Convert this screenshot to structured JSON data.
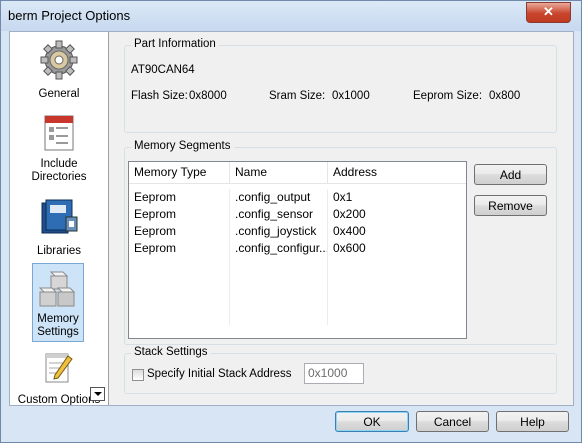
{
  "window": {
    "title": "berm Project Options",
    "close_glyph": "✕"
  },
  "sidebar": {
    "items": [
      {
        "label": "General",
        "icon": "gear-icon"
      },
      {
        "label": "Include Directories",
        "icon": "include-directories-icon"
      },
      {
        "label": "Libraries",
        "icon": "libraries-icon"
      },
      {
        "label": "Memory Settings",
        "icon": "memory-blocks-icon",
        "selected": true
      },
      {
        "label": "Custom Options",
        "icon": "notepad-pencil-icon"
      }
    ]
  },
  "part_info": {
    "group_label": "Part Information",
    "part_name": "AT90CAN64",
    "flash_label": "Flash Size:",
    "flash_value": "0x8000",
    "sram_label": "Sram  Size:",
    "sram_value": "0x1000",
    "eeprom_label": "Eeprom  Size:",
    "eeprom_value": "0x800"
  },
  "memory_segments": {
    "group_label": "Memory Segments",
    "columns": [
      "Memory Type",
      "Name",
      "Address"
    ],
    "rows": [
      [
        "Eeprom",
        ".config_output",
        "0x1"
      ],
      [
        "Eeprom",
        ".config_sensor",
        "0x200"
      ],
      [
        "Eeprom",
        ".config_joystick",
        "0x400"
      ],
      [
        "Eeprom",
        ".config_configur...",
        "0x600"
      ]
    ],
    "add_label": "Add",
    "remove_label": "Remove"
  },
  "stack_settings": {
    "group_label": "Stack Settings",
    "checkbox_label": "Specify Initial Stack Address",
    "checked": false,
    "address_value": "0x1000"
  },
  "footer": {
    "ok_label": "OK",
    "cancel_label": "Cancel",
    "help_label": "Help"
  },
  "colors": {
    "accent": "#3c7fb1",
    "selected_bg": "#cde3f7",
    "close_red": "#c8462d"
  }
}
